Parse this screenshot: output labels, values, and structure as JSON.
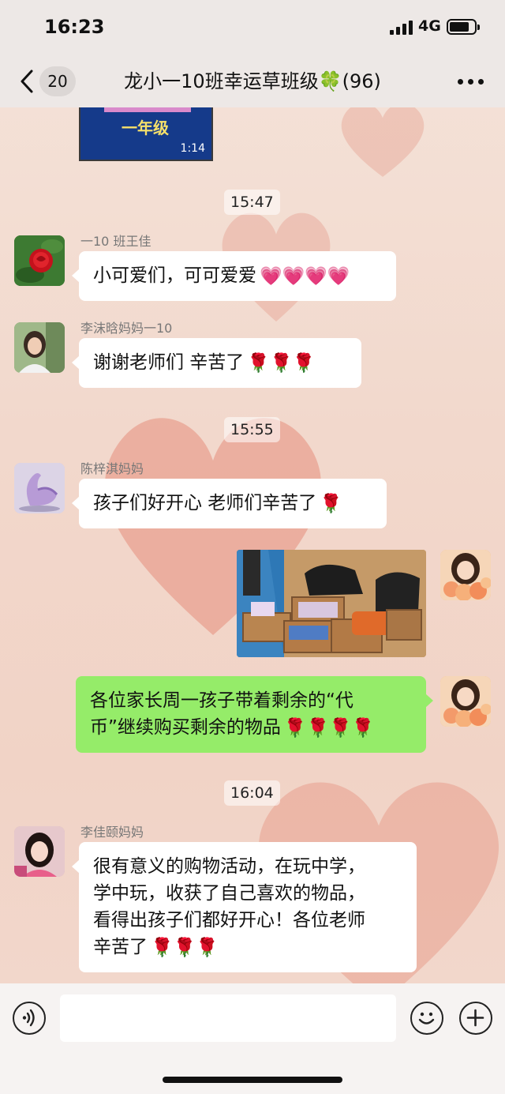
{
  "status_bar": {
    "time": "16:23",
    "network": "4G"
  },
  "nav": {
    "back_count": "20",
    "title": "龙小一10班幸运草班级🍀(96)"
  },
  "video": {
    "caption": "一年级",
    "duration": "1:14"
  },
  "messages": [
    {
      "type": "timestamp",
      "text": "15:47"
    },
    {
      "type": "incoming",
      "sender": "一10 班王佳",
      "text": "小可爱们，可可爱爱",
      "emoji": "💗💗💗💗",
      "avatar_icon": "rose-avatar-icon"
    },
    {
      "type": "incoming",
      "sender": "李沫晗妈妈一10",
      "text": "谢谢老师们  辛苦了",
      "emoji": "🌹🌹🌹",
      "avatar_icon": "woman-portrait-avatar-icon"
    },
    {
      "type": "timestamp",
      "text": "15:55"
    },
    {
      "type": "incoming",
      "sender": "陈梓淇妈妈",
      "text": "孩子们好开心 老师们辛苦了",
      "emoji": "🌹",
      "avatar_icon": "swan-avatar-icon"
    },
    {
      "type": "outgoing-image",
      "description_icon": "shopping-boxes-photo-icon"
    },
    {
      "type": "outgoing",
      "text_line1": "各位家长周一孩子带着剩余的“代",
      "text_line2": "币”继续购买剩余的物品",
      "emoji": "🌹🌹🌹🌹"
    },
    {
      "type": "timestamp",
      "text": "16:04"
    },
    {
      "type": "incoming",
      "sender": "李佳颐妈妈",
      "lines": [
        "很有意义的购物活动，在玩中学，",
        "学中玩，收获了自己喜欢的物品，",
        "看得出孩子们都好开心！各位老师",
        "辛苦了"
      ],
      "emoji": "🌹🌹🌹",
      "avatar_icon": "woman-selfie-avatar-icon"
    }
  ],
  "colors": {
    "outgoing_bubble": "#95ec69",
    "incoming_bubble": "#ffffff",
    "bar_background": "#ede8e6"
  }
}
